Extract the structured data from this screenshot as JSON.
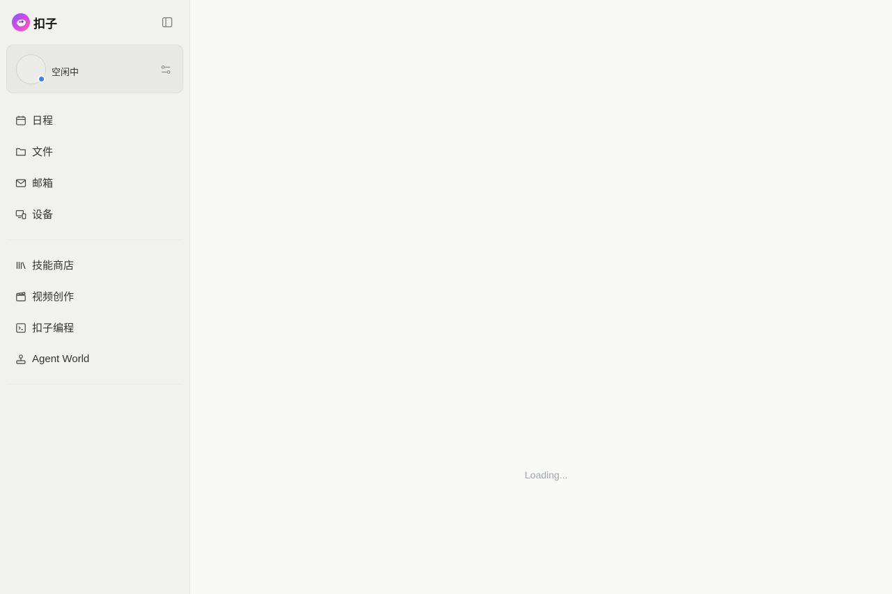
{
  "brand": {
    "name": "扣子"
  },
  "status": {
    "label": "空闲中",
    "dot_color": "#3b82f6"
  },
  "nav_primary": [
    {
      "label": "日程",
      "icon": "calendar-icon"
    },
    {
      "label": "文件",
      "icon": "folder-icon"
    },
    {
      "label": "邮箱",
      "icon": "mail-icon"
    },
    {
      "label": "设备",
      "icon": "devices-icon"
    }
  ],
  "nav_secondary": [
    {
      "label": "技能商店",
      "icon": "library-icon"
    },
    {
      "label": "视频创作",
      "icon": "clapperboard-icon"
    },
    {
      "label": "扣子编程",
      "icon": "terminal-icon"
    },
    {
      "label": "Agent World",
      "icon": "joystick-icon"
    }
  ],
  "main": {
    "loading_text": "Loading..."
  }
}
